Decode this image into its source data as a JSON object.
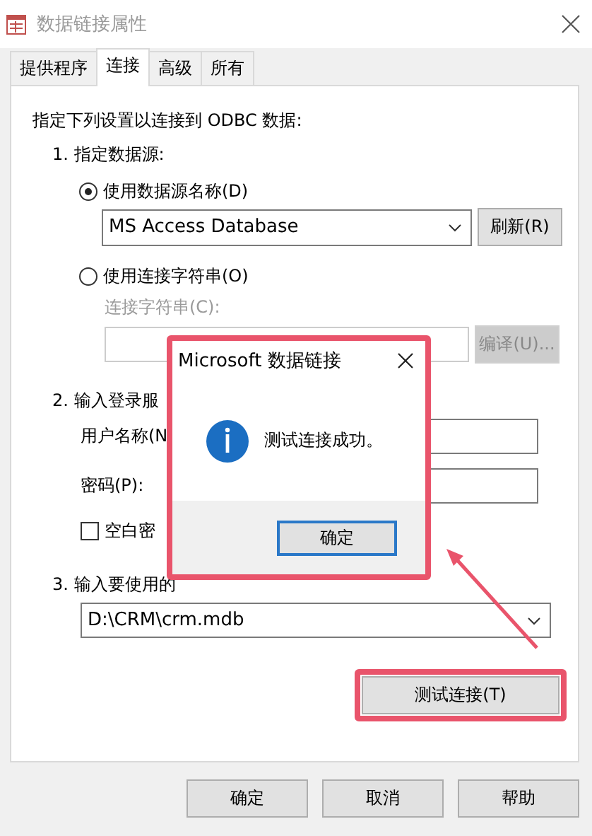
{
  "window": {
    "title": "数据链接属性"
  },
  "tabs": [
    {
      "label": "提供程序",
      "selected": false
    },
    {
      "label": "连接",
      "selected": true
    },
    {
      "label": "高级",
      "selected": false
    },
    {
      "label": "所有",
      "selected": false
    }
  ],
  "panel": {
    "intro": "指定下列设置以连接到 ODBC 数据:",
    "section_1": "1. 指定数据源:",
    "radios": [
      {
        "label": "使用数据源名称(D)",
        "selected": true
      },
      {
        "label": "使用连接字符串(O)",
        "selected": false
      }
    ],
    "dsn_combo": {
      "value": "MS Access Database"
    },
    "refresh_button": {
      "label": "刷新(R)",
      "disabled": false
    },
    "connection_string_label": {
      "label": "连接字符串(C):",
      "disabled": true
    },
    "compile_button": {
      "label": "编译(U)...",
      "disabled": true
    },
    "section_2": "2. 输入登录服",
    "username_label": "用户名称(N",
    "password_label": "密码(P):",
    "blank_password": {
      "label": "空白密",
      "checked": false
    },
    "section_3": "3. 输入要使用的",
    "catalog_combo": {
      "value": "D:\\CRM\\crm.mdb"
    },
    "test_button": {
      "label": "测试连接(T)",
      "highlighted": true
    }
  },
  "buttons": [
    "确定",
    "取消",
    "帮助"
  ],
  "message_box": {
    "title": "Microsoft 数据链接",
    "message": "测试连接成功。",
    "ok": "确定",
    "highlighted": true
  }
}
